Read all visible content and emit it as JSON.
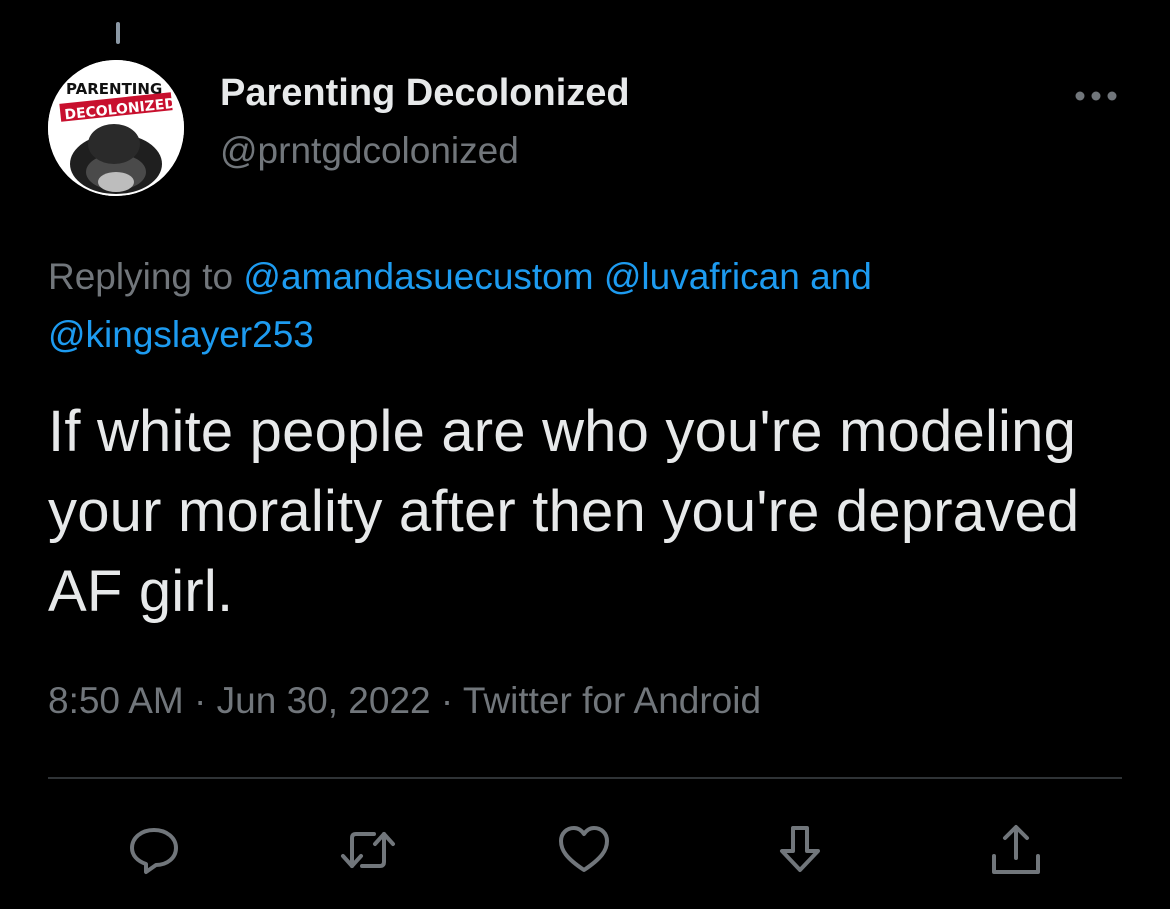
{
  "author": {
    "display_name": "Parenting Decolonized",
    "handle": "@prntgdcolonized",
    "avatar": {
      "text_top": "PARENTING",
      "text_bottom": "DECOLONIZED"
    }
  },
  "reply_context": {
    "prefix": "Replying to",
    "mentions": [
      "@amandasuecustom",
      "@luvafrican",
      "@kingslayer253"
    ],
    "joiner": "and"
  },
  "tweet": {
    "text": "If white people are who you're modeling your morality after then you're depraved AF girl."
  },
  "meta": {
    "time": "8:50 AM",
    "date": "Jun 30, 2022",
    "source": "Twitter for Android",
    "separator": "·"
  },
  "actions": [
    {
      "name": "reply",
      "icon": "reply-icon"
    },
    {
      "name": "retweet",
      "icon": "retweet-icon"
    },
    {
      "name": "like",
      "icon": "heart-icon"
    },
    {
      "name": "download",
      "icon": "download-icon"
    },
    {
      "name": "share",
      "icon": "share-icon"
    }
  ],
  "colors": {
    "background": "#000000",
    "text_primary": "#e7e9ea",
    "text_secondary": "#71767b",
    "link": "#1d9bf0",
    "divider": "#2f3336"
  }
}
